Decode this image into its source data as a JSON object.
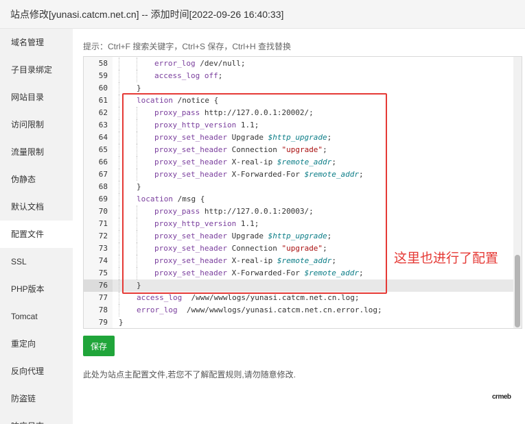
{
  "window": {
    "title": "站点修改[yunasi.catcm.net.cn] -- 添加时间[2022-09-26 16:40:33]"
  },
  "sidebar": {
    "items": [
      {
        "label": "域名管理"
      },
      {
        "label": "子目录绑定"
      },
      {
        "label": "网站目录"
      },
      {
        "label": "访问限制"
      },
      {
        "label": "流量限制"
      },
      {
        "label": "伪静态"
      },
      {
        "label": "默认文档"
      },
      {
        "label": "配置文件",
        "active": true
      },
      {
        "label": "SSL"
      },
      {
        "label": "PHP版本"
      },
      {
        "label": "Tomcat"
      },
      {
        "label": "重定向"
      },
      {
        "label": "反向代理"
      },
      {
        "label": "防盗链"
      },
      {
        "label": "响应日志"
      }
    ]
  },
  "hint": "提示：Ctrl+F 搜索关键字，Ctrl+S 保存，Ctrl+H 查找替换",
  "editor": {
    "current_line": "76",
    "lines": [
      {
        "n": "58",
        "indent": 2,
        "tokens": [
          [
            "kw",
            "error_log"
          ],
          [
            "val",
            " /dev/null;"
          ]
        ]
      },
      {
        "n": "59",
        "indent": 2,
        "tokens": [
          [
            "kw",
            "access_log"
          ],
          [
            "val",
            " "
          ],
          [
            "kw",
            "off"
          ],
          [
            "val",
            ";"
          ]
        ]
      },
      {
        "n": "60",
        "indent": 1,
        "tokens": [
          [
            "val",
            "}"
          ]
        ]
      },
      {
        "n": "61",
        "indent": 1,
        "tokens": [
          [
            "kw",
            "location"
          ],
          [
            "val",
            " /notice {"
          ]
        ]
      },
      {
        "n": "62",
        "indent": 2,
        "tokens": [
          [
            "kw",
            "proxy_pass"
          ],
          [
            "val",
            " http://127.0.0.1:20002/;"
          ]
        ]
      },
      {
        "n": "63",
        "indent": 2,
        "tokens": [
          [
            "kw",
            "proxy_http_version"
          ],
          [
            "val",
            " 1.1;"
          ]
        ]
      },
      {
        "n": "64",
        "indent": 2,
        "tokens": [
          [
            "kw",
            "proxy_set_header"
          ],
          [
            "val",
            " Upgrade "
          ],
          [
            "var",
            "$http_upgrade"
          ],
          [
            "val",
            ";"
          ]
        ]
      },
      {
        "n": "65",
        "indent": 2,
        "tokens": [
          [
            "kw",
            "proxy_set_header"
          ],
          [
            "val",
            " Connection "
          ],
          [
            "str",
            "\"upgrade\""
          ],
          [
            "val",
            ";"
          ]
        ]
      },
      {
        "n": "66",
        "indent": 2,
        "tokens": [
          [
            "kw",
            "proxy_set_header"
          ],
          [
            "val",
            " X-real-ip "
          ],
          [
            "var",
            "$remote_addr"
          ],
          [
            "val",
            ";"
          ]
        ]
      },
      {
        "n": "67",
        "indent": 2,
        "tokens": [
          [
            "kw",
            "proxy_set_header"
          ],
          [
            "val",
            " X-Forwarded-For "
          ],
          [
            "var",
            "$remote_addr"
          ],
          [
            "val",
            ";"
          ]
        ]
      },
      {
        "n": "68",
        "indent": 1,
        "tokens": [
          [
            "val",
            "}"
          ]
        ]
      },
      {
        "n": "69",
        "indent": 1,
        "tokens": [
          [
            "kw",
            "location"
          ],
          [
            "val",
            " /msg {"
          ]
        ]
      },
      {
        "n": "70",
        "indent": 2,
        "tokens": [
          [
            "kw",
            "proxy_pass"
          ],
          [
            "val",
            " http://127.0.0.1:20003/;"
          ]
        ]
      },
      {
        "n": "71",
        "indent": 2,
        "tokens": [
          [
            "kw",
            "proxy_http_version"
          ],
          [
            "val",
            " 1.1;"
          ]
        ]
      },
      {
        "n": "72",
        "indent": 2,
        "tokens": [
          [
            "kw",
            "proxy_set_header"
          ],
          [
            "val",
            " Upgrade "
          ],
          [
            "var",
            "$http_upgrade"
          ],
          [
            "val",
            ";"
          ]
        ]
      },
      {
        "n": "73",
        "indent": 2,
        "tokens": [
          [
            "kw",
            "proxy_set_header"
          ],
          [
            "val",
            " Connection "
          ],
          [
            "str",
            "\"upgrade\""
          ],
          [
            "val",
            ";"
          ]
        ]
      },
      {
        "n": "74",
        "indent": 2,
        "tokens": [
          [
            "kw",
            "proxy_set_header"
          ],
          [
            "val",
            " X-real-ip "
          ],
          [
            "var",
            "$remote_addr"
          ],
          [
            "val",
            ";"
          ]
        ]
      },
      {
        "n": "75",
        "indent": 2,
        "tokens": [
          [
            "kw",
            "proxy_set_header"
          ],
          [
            "val",
            " X-Forwarded-For "
          ],
          [
            "var",
            "$remote_addr"
          ],
          [
            "val",
            ";"
          ]
        ]
      },
      {
        "n": "76",
        "indent": 1,
        "tokens": [
          [
            "val",
            "}"
          ]
        ]
      },
      {
        "n": "77",
        "indent": 1,
        "tokens": [
          [
            "kw",
            "access_log"
          ],
          [
            "val",
            "  /www/wwwlogs/yunasi.catcm.net.cn.log;"
          ]
        ]
      },
      {
        "n": "78",
        "indent": 1,
        "tokens": [
          [
            "kw",
            "error_log"
          ],
          [
            "val",
            "  /www/wwwlogs/yunasi.catcm.net.cn.error.log;"
          ]
        ]
      },
      {
        "n": "79",
        "indent": 0,
        "tokens": [
          [
            "val",
            "}"
          ]
        ]
      }
    ]
  },
  "annotation": "这里也进行了配置",
  "save_label": "保存",
  "note": "此处为站点主配置文件,若您不了解配置规则,请勿随意修改.",
  "brand": "crmeb",
  "colors": {
    "accent": "#20a53a",
    "highlight": "#e53935",
    "keyword": "#7a3e9d",
    "variable": "#0a7c86",
    "string": "#a11111"
  }
}
